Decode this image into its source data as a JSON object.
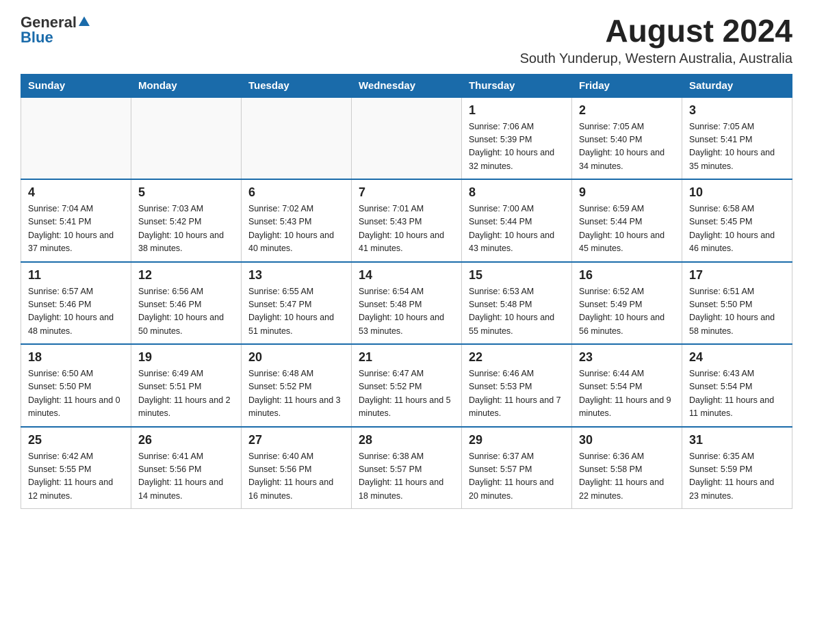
{
  "header": {
    "logo_general": "General",
    "logo_blue": "Blue",
    "month_year": "August 2024",
    "location": "South Yunderup, Western Australia, Australia"
  },
  "weekdays": [
    "Sunday",
    "Monday",
    "Tuesday",
    "Wednesday",
    "Thursday",
    "Friday",
    "Saturday"
  ],
  "weeks": [
    [
      {
        "day": "",
        "sunrise": "",
        "sunset": "",
        "daylight": ""
      },
      {
        "day": "",
        "sunrise": "",
        "sunset": "",
        "daylight": ""
      },
      {
        "day": "",
        "sunrise": "",
        "sunset": "",
        "daylight": ""
      },
      {
        "day": "",
        "sunrise": "",
        "sunset": "",
        "daylight": ""
      },
      {
        "day": "1",
        "sunrise": "Sunrise: 7:06 AM",
        "sunset": "Sunset: 5:39 PM",
        "daylight": "Daylight: 10 hours and 32 minutes."
      },
      {
        "day": "2",
        "sunrise": "Sunrise: 7:05 AM",
        "sunset": "Sunset: 5:40 PM",
        "daylight": "Daylight: 10 hours and 34 minutes."
      },
      {
        "day": "3",
        "sunrise": "Sunrise: 7:05 AM",
        "sunset": "Sunset: 5:41 PM",
        "daylight": "Daylight: 10 hours and 35 minutes."
      }
    ],
    [
      {
        "day": "4",
        "sunrise": "Sunrise: 7:04 AM",
        "sunset": "Sunset: 5:41 PM",
        "daylight": "Daylight: 10 hours and 37 minutes."
      },
      {
        "day": "5",
        "sunrise": "Sunrise: 7:03 AM",
        "sunset": "Sunset: 5:42 PM",
        "daylight": "Daylight: 10 hours and 38 minutes."
      },
      {
        "day": "6",
        "sunrise": "Sunrise: 7:02 AM",
        "sunset": "Sunset: 5:43 PM",
        "daylight": "Daylight: 10 hours and 40 minutes."
      },
      {
        "day": "7",
        "sunrise": "Sunrise: 7:01 AM",
        "sunset": "Sunset: 5:43 PM",
        "daylight": "Daylight: 10 hours and 41 minutes."
      },
      {
        "day": "8",
        "sunrise": "Sunrise: 7:00 AM",
        "sunset": "Sunset: 5:44 PM",
        "daylight": "Daylight: 10 hours and 43 minutes."
      },
      {
        "day": "9",
        "sunrise": "Sunrise: 6:59 AM",
        "sunset": "Sunset: 5:44 PM",
        "daylight": "Daylight: 10 hours and 45 minutes."
      },
      {
        "day": "10",
        "sunrise": "Sunrise: 6:58 AM",
        "sunset": "Sunset: 5:45 PM",
        "daylight": "Daylight: 10 hours and 46 minutes."
      }
    ],
    [
      {
        "day": "11",
        "sunrise": "Sunrise: 6:57 AM",
        "sunset": "Sunset: 5:46 PM",
        "daylight": "Daylight: 10 hours and 48 minutes."
      },
      {
        "day": "12",
        "sunrise": "Sunrise: 6:56 AM",
        "sunset": "Sunset: 5:46 PM",
        "daylight": "Daylight: 10 hours and 50 minutes."
      },
      {
        "day": "13",
        "sunrise": "Sunrise: 6:55 AM",
        "sunset": "Sunset: 5:47 PM",
        "daylight": "Daylight: 10 hours and 51 minutes."
      },
      {
        "day": "14",
        "sunrise": "Sunrise: 6:54 AM",
        "sunset": "Sunset: 5:48 PM",
        "daylight": "Daylight: 10 hours and 53 minutes."
      },
      {
        "day": "15",
        "sunrise": "Sunrise: 6:53 AM",
        "sunset": "Sunset: 5:48 PM",
        "daylight": "Daylight: 10 hours and 55 minutes."
      },
      {
        "day": "16",
        "sunrise": "Sunrise: 6:52 AM",
        "sunset": "Sunset: 5:49 PM",
        "daylight": "Daylight: 10 hours and 56 minutes."
      },
      {
        "day": "17",
        "sunrise": "Sunrise: 6:51 AM",
        "sunset": "Sunset: 5:50 PM",
        "daylight": "Daylight: 10 hours and 58 minutes."
      }
    ],
    [
      {
        "day": "18",
        "sunrise": "Sunrise: 6:50 AM",
        "sunset": "Sunset: 5:50 PM",
        "daylight": "Daylight: 11 hours and 0 minutes."
      },
      {
        "day": "19",
        "sunrise": "Sunrise: 6:49 AM",
        "sunset": "Sunset: 5:51 PM",
        "daylight": "Daylight: 11 hours and 2 minutes."
      },
      {
        "day": "20",
        "sunrise": "Sunrise: 6:48 AM",
        "sunset": "Sunset: 5:52 PM",
        "daylight": "Daylight: 11 hours and 3 minutes."
      },
      {
        "day": "21",
        "sunrise": "Sunrise: 6:47 AM",
        "sunset": "Sunset: 5:52 PM",
        "daylight": "Daylight: 11 hours and 5 minutes."
      },
      {
        "day": "22",
        "sunrise": "Sunrise: 6:46 AM",
        "sunset": "Sunset: 5:53 PM",
        "daylight": "Daylight: 11 hours and 7 minutes."
      },
      {
        "day": "23",
        "sunrise": "Sunrise: 6:44 AM",
        "sunset": "Sunset: 5:54 PM",
        "daylight": "Daylight: 11 hours and 9 minutes."
      },
      {
        "day": "24",
        "sunrise": "Sunrise: 6:43 AM",
        "sunset": "Sunset: 5:54 PM",
        "daylight": "Daylight: 11 hours and 11 minutes."
      }
    ],
    [
      {
        "day": "25",
        "sunrise": "Sunrise: 6:42 AM",
        "sunset": "Sunset: 5:55 PM",
        "daylight": "Daylight: 11 hours and 12 minutes."
      },
      {
        "day": "26",
        "sunrise": "Sunrise: 6:41 AM",
        "sunset": "Sunset: 5:56 PM",
        "daylight": "Daylight: 11 hours and 14 minutes."
      },
      {
        "day": "27",
        "sunrise": "Sunrise: 6:40 AM",
        "sunset": "Sunset: 5:56 PM",
        "daylight": "Daylight: 11 hours and 16 minutes."
      },
      {
        "day": "28",
        "sunrise": "Sunrise: 6:38 AM",
        "sunset": "Sunset: 5:57 PM",
        "daylight": "Daylight: 11 hours and 18 minutes."
      },
      {
        "day": "29",
        "sunrise": "Sunrise: 6:37 AM",
        "sunset": "Sunset: 5:57 PM",
        "daylight": "Daylight: 11 hours and 20 minutes."
      },
      {
        "day": "30",
        "sunrise": "Sunrise: 6:36 AM",
        "sunset": "Sunset: 5:58 PM",
        "daylight": "Daylight: 11 hours and 22 minutes."
      },
      {
        "day": "31",
        "sunrise": "Sunrise: 6:35 AM",
        "sunset": "Sunset: 5:59 PM",
        "daylight": "Daylight: 11 hours and 23 minutes."
      }
    ]
  ]
}
